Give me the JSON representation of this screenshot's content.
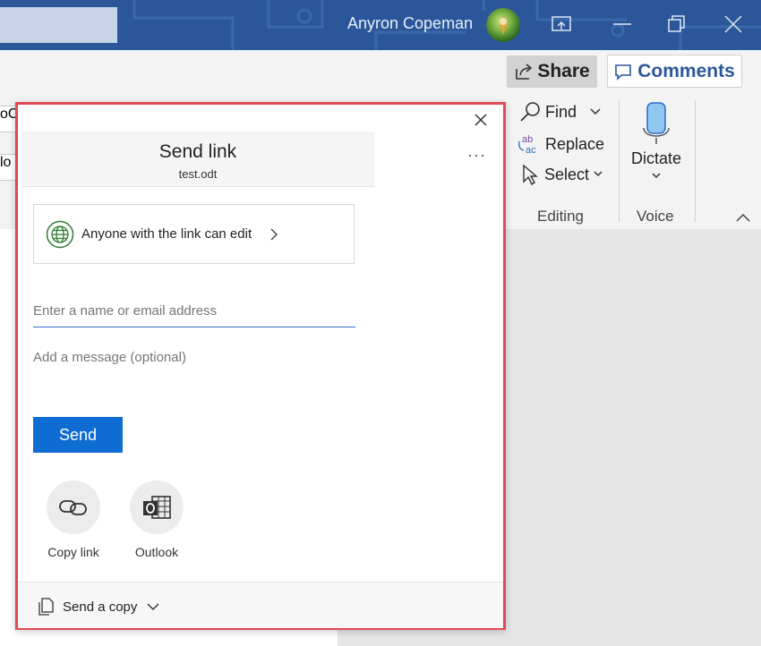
{
  "titlebar": {
    "user_name": "Anyron Copeman"
  },
  "ribbon": {
    "share_label": "Share",
    "comments_label": "Comments",
    "find_label": "Find",
    "replace_label": "Replace",
    "select_label": "Select",
    "editing_group": "Editing",
    "dictate_label": "Dictate",
    "voice_group": "Voice",
    "left_edge_1": "oCo",
    "left_edge_2": "lo"
  },
  "dialog": {
    "title": "Send link",
    "filename": "test.odt",
    "permission": "Anyone with the link can edit",
    "name_placeholder": "Enter a name or email address",
    "message_placeholder": "Add a message (optional)",
    "send_label": "Send",
    "options": [
      {
        "label": "Copy link",
        "icon": "link-icon"
      },
      {
        "label": "Outlook",
        "icon": "outlook-icon"
      }
    ],
    "footer_label": "Send a copy"
  },
  "colors": {
    "titlebar": "#2b579a",
    "accent": "#0f6cd2",
    "highlight_border": "#e04a52"
  }
}
